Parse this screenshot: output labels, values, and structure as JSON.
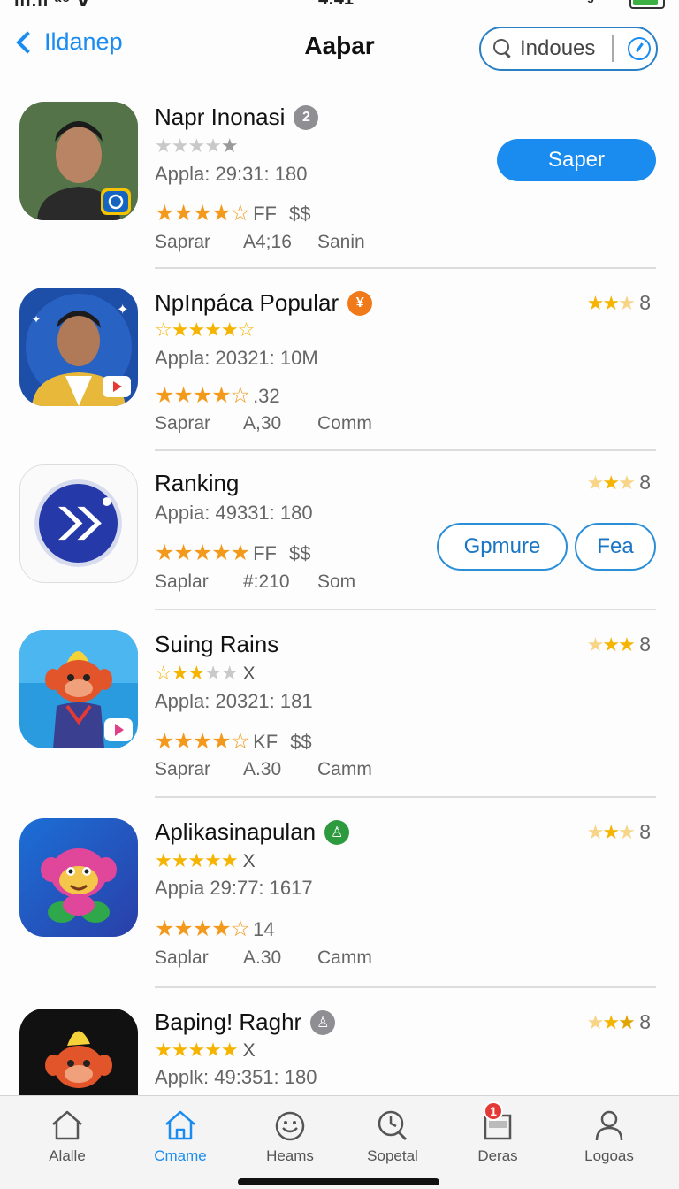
{
  "status_bar": {
    "left": "ııı.ıl ᵃᵒ ∀",
    "center": "4:41",
    "right": "ᴵ ᵍ ᵋᵛ ᴴ"
  },
  "nav": {
    "back_label": "Ildanep",
    "title": "Aaþar",
    "search_placeholder": "Indoues"
  },
  "apps": [
    {
      "name": "Napr Inonasi",
      "badge": "2",
      "badge_color": "#8e8e93",
      "star_line": "☆☆☆☆★",
      "meta": "Appla: 29:31: 180",
      "rating_suffix": "FF",
      "rating_stars_value": 4.5,
      "dollar": "$$",
      "cat": [
        "Saprar",
        "A4;16",
        "Sanin"
      ],
      "action": "Saper"
    },
    {
      "name": "NpInpáca Popular",
      "badge": "¥",
      "badge_color": "#f07a1a",
      "star_line_on": 4,
      "meta": "Appla: 20321: 10M",
      "rating_suffix": ".32",
      "rating_stars_value": 4.5,
      "cat": [
        "Saprar",
        "A,30",
        "Comm"
      ],
      "right_rating": "8"
    },
    {
      "name": "Ranking",
      "meta": "Appia: 49331: 180",
      "rating_suffix": "FF",
      "rating_stars_value": 5,
      "dollar": "$$",
      "cat": [
        "Saplar",
        "#:210",
        "Som"
      ],
      "right_rating": "8",
      "action_primary": "Gpmure",
      "action_secondary": "Fea"
    },
    {
      "name": "Suing Rains",
      "star_line_on": 2,
      "star_line_x": "X",
      "meta": "Appla: 20321: 181",
      "rating_suffix": "KF",
      "rating_stars_value": 4.5,
      "dollar": "$$",
      "cat": [
        "Saprar",
        "A.30",
        "Camm"
      ],
      "right_rating": "8"
    },
    {
      "name": "Aplikasinapulan",
      "badge": "♙",
      "badge_color": "#2e9a3e",
      "star_line_on": 5,
      "star_line_x": "X",
      "meta": "Appia 29:77: 1617",
      "rating_suffix": "14",
      "rating_stars_value": 4.5,
      "cat": [
        "Saplar",
        "A.30",
        "Camm"
      ],
      "right_rating": "8"
    },
    {
      "name": "Baping! Raghr",
      "badge": "♙",
      "badge_color": "#8e8e93",
      "star_line_on": 5,
      "star_line_x": "X",
      "meta": "Applk: 49:351: 180",
      "right_rating": "8"
    }
  ],
  "tabs": [
    {
      "label": "Alalle",
      "icon": "house-icon"
    },
    {
      "label": "Cmame",
      "icon": "home-icon",
      "active": true
    },
    {
      "label": "Heams",
      "icon": "smiley-icon"
    },
    {
      "label": "Sopetal",
      "icon": "search-icon"
    },
    {
      "label": "Deras",
      "icon": "inbox-icon",
      "notification": "1"
    },
    {
      "label": "Logoas",
      "icon": "person-icon"
    }
  ],
  "colors": {
    "accent": "#1a8cf0",
    "star": "#f39a1c",
    "gold": "#f5b400"
  }
}
